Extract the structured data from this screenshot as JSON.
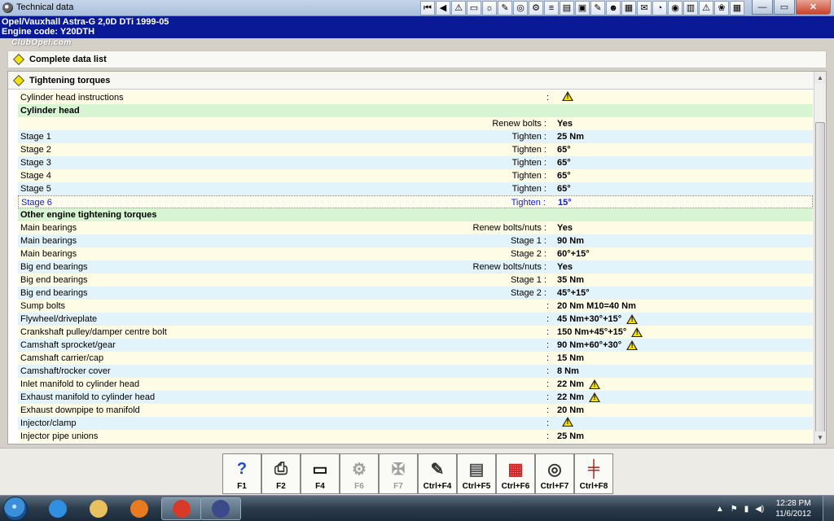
{
  "window": {
    "title": "Technical data",
    "toolbar_glyphs": [
      "⏮",
      "◀",
      "⚠",
      "▭",
      "☼",
      "✎",
      "◎",
      "⚙",
      "≡",
      "▤",
      "▣",
      "✎",
      "☻",
      "▦",
      "✉",
      "◔",
      "◉",
      "▥",
      "⚠",
      "❀",
      "▦"
    ],
    "controls": {
      "minimize": "—",
      "maximize": "▭",
      "close": "✕"
    }
  },
  "vehicle": {
    "line1": "Opel/Vauxhall  Astra-G  2,0D DTi 1999-05",
    "line2": "Engine code: Y20DTH",
    "watermark": "ClubOpel.com"
  },
  "datalist": {
    "label": "Complete data list"
  },
  "section": {
    "label": "Tightening torques"
  },
  "rows": [
    {
      "type": "yellow",
      "label": "Cylinder head instructions",
      "mid": "",
      "colon": ":",
      "value": "",
      "warn": true
    },
    {
      "type": "green",
      "label": "Cylinder head",
      "mid": "",
      "colon": "",
      "value": "",
      "warn": false
    },
    {
      "type": "yellow",
      "label": "",
      "mid": "Renew bolts :",
      "colon": "",
      "value": "Yes",
      "warn": false
    },
    {
      "type": "blue",
      "label": "Stage 1",
      "mid": "Tighten :",
      "colon": "",
      "value": "25 Nm",
      "warn": false
    },
    {
      "type": "yellow",
      "label": "Stage 2",
      "mid": "Tighten :",
      "colon": "",
      "value": "65°",
      "warn": false
    },
    {
      "type": "blue",
      "label": "Stage 3",
      "mid": "Tighten :",
      "colon": "",
      "value": "65°",
      "warn": false
    },
    {
      "type": "yellow",
      "label": "Stage 4",
      "mid": "Tighten :",
      "colon": "",
      "value": "65°",
      "warn": false
    },
    {
      "type": "blue",
      "label": "Stage 5",
      "mid": "Tighten :",
      "colon": "",
      "value": "65°",
      "warn": false
    },
    {
      "type": "selected",
      "label": "Stage 6",
      "mid": "Tighten :",
      "colon": "",
      "value": "15°",
      "warn": false
    },
    {
      "type": "green",
      "label": "Other engine tightening torques",
      "mid": "",
      "colon": "",
      "value": "",
      "warn": false
    },
    {
      "type": "yellow",
      "label": "Main bearings",
      "mid": "Renew bolts/nuts :",
      "colon": "",
      "value": "Yes",
      "warn": false
    },
    {
      "type": "blue",
      "label": "Main bearings",
      "mid": "Stage 1 :",
      "colon": "",
      "value": "90 Nm",
      "warn": false
    },
    {
      "type": "yellow",
      "label": "Main bearings",
      "mid": "Stage 2 :",
      "colon": "",
      "value": "60°+15°",
      "warn": false
    },
    {
      "type": "blue",
      "label": "Big end bearings",
      "mid": "Renew bolts/nuts :",
      "colon": "",
      "value": "Yes",
      "warn": false
    },
    {
      "type": "yellow",
      "label": "Big end bearings",
      "mid": "Stage 1 :",
      "colon": "",
      "value": "35 Nm",
      "warn": false
    },
    {
      "type": "blue",
      "label": "Big end bearings",
      "mid": "Stage 2 :",
      "colon": "",
      "value": "45°+15°",
      "warn": false
    },
    {
      "type": "yellow",
      "label": "Sump bolts",
      "mid": "",
      "colon": ":",
      "value": "20 Nm M10=40 Nm",
      "warn": false
    },
    {
      "type": "blue",
      "label": "Flywheel/driveplate",
      "mid": "",
      "colon": ":",
      "value": "45 Nm+30°+15°",
      "warn": true
    },
    {
      "type": "yellow",
      "label": "Crankshaft pulley/damper centre bolt",
      "mid": "",
      "colon": ":",
      "value": "150 Nm+45°+15°",
      "warn": true
    },
    {
      "type": "blue",
      "label": "Camshaft sprocket/gear",
      "mid": "",
      "colon": ":",
      "value": "90 Nm+60°+30°",
      "warn": true
    },
    {
      "type": "yellow",
      "label": "Camshaft carrier/cap",
      "mid": "",
      "colon": ":",
      "value": "15 Nm",
      "warn": false
    },
    {
      "type": "blue",
      "label": "Camshaft/rocker cover",
      "mid": "",
      "colon": ":",
      "value": "8 Nm",
      "warn": false
    },
    {
      "type": "yellow",
      "label": "Inlet manifold to cylinder head",
      "mid": "",
      "colon": ":",
      "value": "22 Nm",
      "warn": true
    },
    {
      "type": "blue",
      "label": "Exhaust manifold to cylinder head",
      "mid": "",
      "colon": ":",
      "value": "22 Nm",
      "warn": true
    },
    {
      "type": "yellow",
      "label": "Exhaust downpipe to manifold",
      "mid": "",
      "colon": ":",
      "value": "20 Nm",
      "warn": false
    },
    {
      "type": "blue",
      "label": "Injector/clamp",
      "mid": "",
      "colon": ":",
      "value": "",
      "warn": true
    },
    {
      "type": "yellow",
      "label": "Injector pipe unions",
      "mid": "",
      "colon": ":",
      "value": "25 Nm",
      "warn": false
    }
  ],
  "fkeys": [
    {
      "key": "F1",
      "icon": "help-icon",
      "glyph": "?",
      "color": "#1a4fd0",
      "enabled": true
    },
    {
      "key": "F2",
      "icon": "printer-icon",
      "glyph": "⎙",
      "color": "#333333",
      "enabled": true
    },
    {
      "key": "F4",
      "icon": "screen-icon",
      "glyph": "▭",
      "color": "#111111",
      "enabled": true
    },
    {
      "key": "F6",
      "icon": "pin-data-icon",
      "glyph": "⚙",
      "color": "#a0a0a0",
      "enabled": false
    },
    {
      "key": "F7",
      "icon": "wrench-icon",
      "glyph": "✠",
      "color": "#a0a0a0",
      "enabled": false
    },
    {
      "key": "Ctrl+F4",
      "icon": "notes-icon",
      "glyph": "✎",
      "color": "#333333",
      "enabled": true
    },
    {
      "key": "Ctrl+F5",
      "icon": "diagram-icon",
      "glyph": "▤",
      "color": "#555555",
      "enabled": true
    },
    {
      "key": "Ctrl+F6",
      "icon": "calculator-icon",
      "glyph": "▦",
      "color": "#d02020",
      "enabled": true
    },
    {
      "key": "Ctrl+F7",
      "icon": "magnifier-icon",
      "glyph": "◎",
      "color": "#333333",
      "enabled": true
    },
    {
      "key": "Ctrl+F8",
      "icon": "car-lift-icon",
      "glyph": "╪",
      "color": "#b01818",
      "enabled": true
    }
  ],
  "taskbar": {
    "apps": [
      {
        "name": "ie",
        "color": "#2f8fe0",
        "active": false
      },
      {
        "name": "explorer",
        "color": "#e8c060",
        "active": false
      },
      {
        "name": "media",
        "color": "#e87a20",
        "active": false
      },
      {
        "name": "chrome",
        "color": "#d83a2a",
        "active": true
      },
      {
        "name": "autodata",
        "color": "#3a4a8a",
        "active": true
      }
    ],
    "time": "12:28 PM",
    "date": "11/6/2012"
  },
  "colors": {
    "header_blue": "#0a1a96",
    "row_yellow": "#fefce5",
    "row_blue": "#e3f3fc",
    "row_green": "#d7f5d2",
    "selected_text": "#1020c8",
    "warning_yellow": "#f7e000"
  }
}
